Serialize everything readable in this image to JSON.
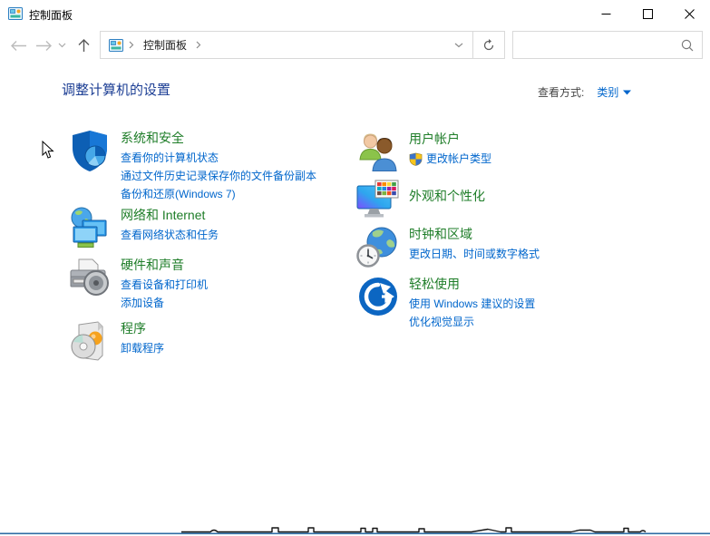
{
  "window": {
    "title": "控制面板"
  },
  "nav": {
    "breadcrumb_root": "控制面板",
    "search_value": ""
  },
  "page": {
    "title": "调整计算机的设置",
    "view_by_label": "查看方式:",
    "view_by_value": "类别"
  },
  "colors": {
    "page-title": "#1c3e94",
    "category-title": "#1e7d28",
    "link": "#0066cc",
    "bottom-line": "#2e6da4"
  },
  "categories": {
    "left": [
      {
        "title": "系统和安全",
        "links": [
          "查看你的计算机状态",
          "通过文件历史记录保存你的文件备份副本",
          "备份和还原(Windows 7)"
        ]
      },
      {
        "title": "网络和 Internet",
        "links": [
          "查看网络状态和任务"
        ]
      },
      {
        "title": "硬件和声音",
        "links": [
          "查看设备和打印机",
          "添加设备"
        ]
      },
      {
        "title": "程序",
        "links": [
          "卸载程序"
        ]
      }
    ],
    "right": [
      {
        "title": "用户帐户",
        "links": [
          "更改帐户类型"
        ]
      },
      {
        "title": "外观和个性化",
        "links": []
      },
      {
        "title": "时钟和区域",
        "links": [
          "更改日期、时间或数字格式"
        ]
      },
      {
        "title": "轻松使用",
        "links": [
          "使用 Windows 建议的设置",
          "优化视觉显示"
        ]
      }
    ]
  }
}
